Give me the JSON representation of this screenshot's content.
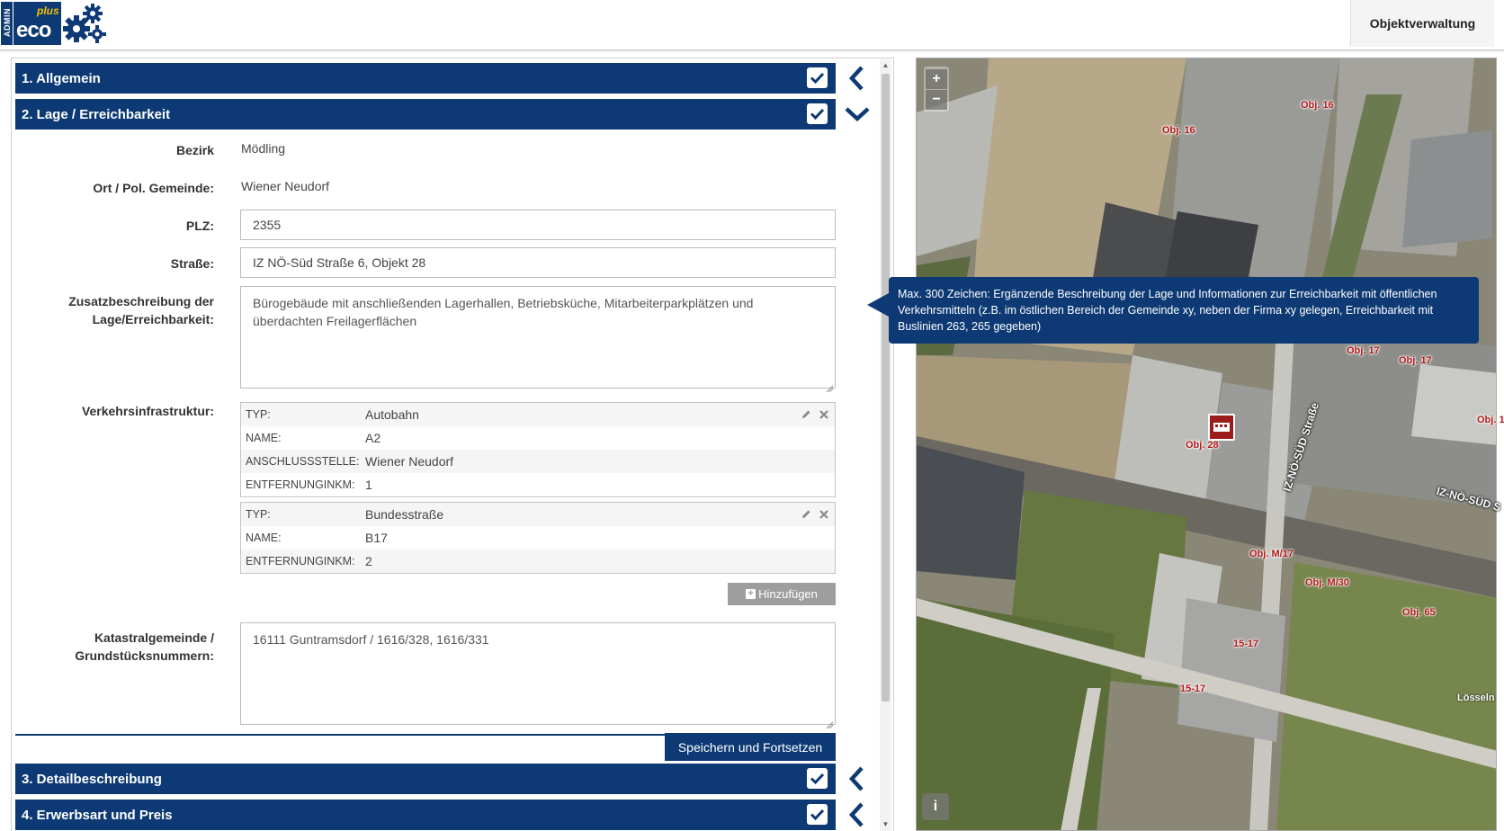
{
  "header": {
    "logo": {
      "admin": "ADMIN",
      "eco": "eco",
      "plus": "plus"
    },
    "tab_label": "Objektverwaltung"
  },
  "sections": [
    {
      "label": "1. Allgemein",
      "checked": true,
      "arrow": "chevron-left"
    },
    {
      "label": "2. Lage / Erreichbarkeit",
      "checked": true,
      "arrow": "chevron-down"
    },
    {
      "label": "3. Detailbeschreibung",
      "checked": true,
      "arrow": "chevron-left"
    },
    {
      "label": "4. Erwerbsart und Preis",
      "checked": true,
      "arrow": "chevron-left"
    }
  ],
  "form": {
    "bezirk": {
      "label": "Bezirk",
      "value": "Mödling"
    },
    "ort": {
      "label": "Ort / Pol. Gemeinde:",
      "value": "Wiener Neudorf"
    },
    "plz": {
      "label": "PLZ:",
      "value": "2355"
    },
    "strasse": {
      "label": "Straße:",
      "value": "IZ NÖ-Süd Straße 6, Objekt 28"
    },
    "zusatz": {
      "label_line1": "Zusatzbeschreibung der",
      "label_line2": "Lage/Erreichbarkeit:",
      "value": "Bürogebäude mit anschließenden Lagerhallen, Betriebsküche, Mitarbeiterparkplätzen und überdachten Freilagerflächen"
    },
    "verkehr": {
      "label": "Verkehrsinfrastruktur:",
      "entries": [
        {
          "rows": [
            {
              "key": "TYP:",
              "value": "Autobahn"
            },
            {
              "key": "NAME:",
              "value": "A2"
            },
            {
              "key": "ANSCHLUSSSTELLE:",
              "value": "Wiener Neudorf"
            },
            {
              "key": "ENTFERNUNGINKM:",
              "value": "1"
            }
          ]
        },
        {
          "rows": [
            {
              "key": "TYP:",
              "value": "Bundesstraße"
            },
            {
              "key": "NAME:",
              "value": "B17"
            },
            {
              "key": "ENTFERNUNGINKM:",
              "value": "2"
            }
          ]
        }
      ],
      "add_label": "Hinzufügen"
    },
    "kataster": {
      "label_line1": "Katastralgemeinde /",
      "label_line2": "Grundstücksnummern:",
      "value": "16111 Guntramsdorf / 1616/328, 1616/331"
    },
    "save_label": "Speichern und Fortsetzen"
  },
  "tooltip": {
    "text": "Max. 300 Zeichen: Ergänzende Beschreibung der Lage und Informationen zur Erreichbarkeit mit öffentlichen Verkehrsmitteln (z.B. im östlichen Bereich der Gemeinde xy, neben der Firma xy gelegen, Erreichbarkeit mit Buslinien 263, 265 gegeben)"
  },
  "map": {
    "zoom_in": "+",
    "zoom_out": "−",
    "info": "i",
    "labels": [
      "Obj. 16",
      "Obj. 16",
      "Obj. 17",
      "Obj. 17",
      "Obj. 1",
      "Obj. 28",
      "Obj. M/17",
      "Obj. M/30",
      "Obj. 65",
      "15-17",
      "15-17",
      "Lösseln"
    ],
    "streets": [
      "IZ-NÖ-SÜD Straße",
      "IZ-NÖ-SÜD S"
    ]
  },
  "colors": {
    "brand": "#0d3a74",
    "map_label": "#b01818",
    "add_button": "#9e9e9e"
  }
}
